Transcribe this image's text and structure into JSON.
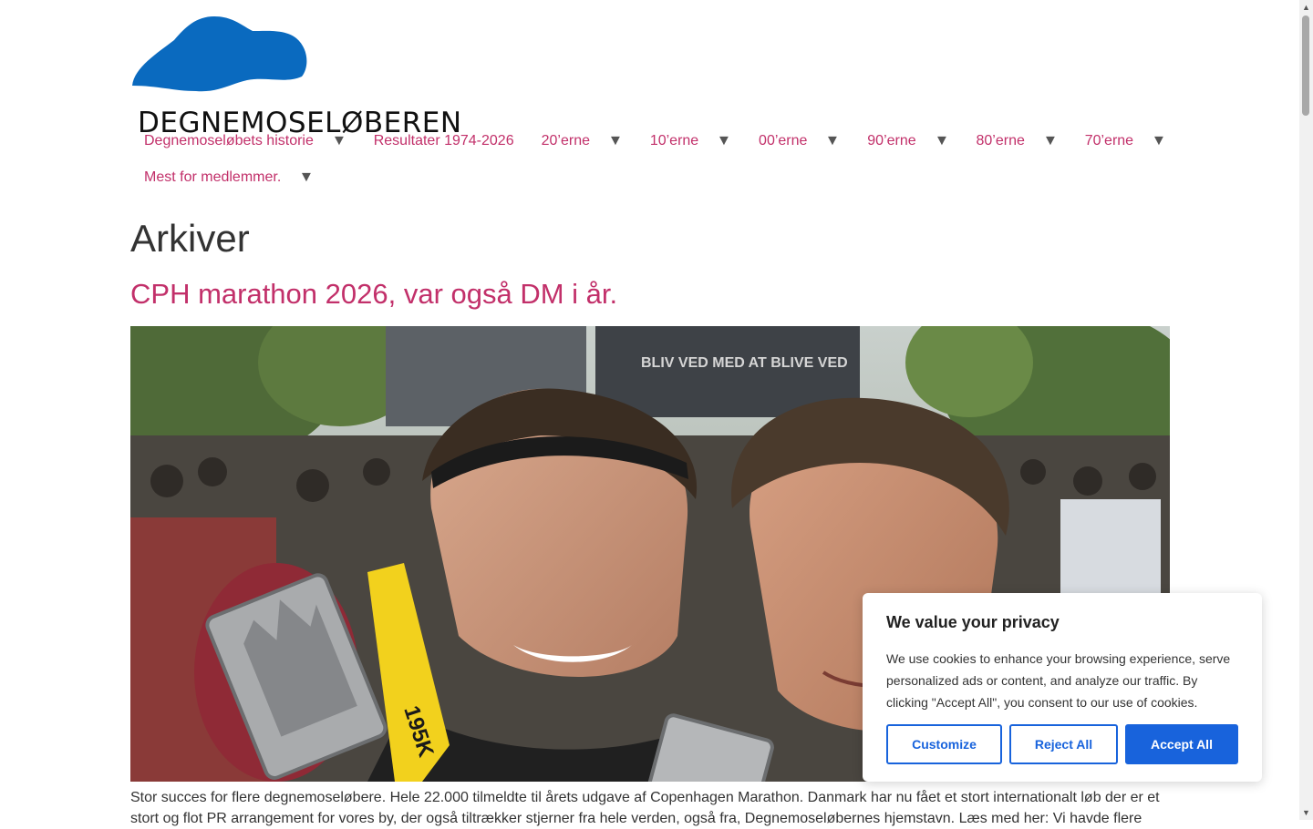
{
  "site": {
    "logo_text": "DEGNEMOSELØBEREN",
    "logo_color": "#0a6abf"
  },
  "nav": {
    "row1": [
      {
        "label": "Degnemoseløbets historie",
        "has_submenu": true
      },
      {
        "label": "Resultater 1974-2026",
        "has_submenu": false
      },
      {
        "label": "20’erne",
        "has_submenu": true
      },
      {
        "label": "10’erne",
        "has_submenu": true
      },
      {
        "label": "00’erne",
        "has_submenu": true
      },
      {
        "label": "90’erne",
        "has_submenu": true
      },
      {
        "label": "80’erne",
        "has_submenu": true
      },
      {
        "label": "70’erne",
        "has_submenu": true
      }
    ],
    "row2": [
      {
        "label": "Mest for medlemmer.",
        "has_submenu": true
      }
    ],
    "arrow_glyph": "▼",
    "link_color": "#c2306a"
  },
  "archive": {
    "title": "Arkiver"
  },
  "post": {
    "title": "CPH marathon 2026, var også DM i år.",
    "image_banner_text": "BLIV VED MED AT BLIVE VED",
    "medal_ribbon_text": "195K",
    "excerpt": "Stor succes for flere degnemoseløbere. Hele 22.000 tilmeldte til årets udgave af Copenhagen Marathon. Danmark har nu fået et stort internationalt løb der er et stort og flot PR arrangement for vores by, der også tiltrækker stjerner fra hele verden, også fra, Degnemoseløbernes hjemstavn. Læs med her: Vi havde flere"
  },
  "cookie": {
    "title": "We value your privacy",
    "text": "We use cookies to enhance your browsing experience, serve personalized ads or content, and analyze our traffic. By clicking \"Accept All\", you consent to our use of cookies.",
    "customize": "Customize",
    "reject": "Reject All",
    "accept": "Accept All",
    "accent": "#1863dc"
  },
  "scrollbar": {
    "up_glyph": "▲",
    "down_glyph": "▼"
  }
}
